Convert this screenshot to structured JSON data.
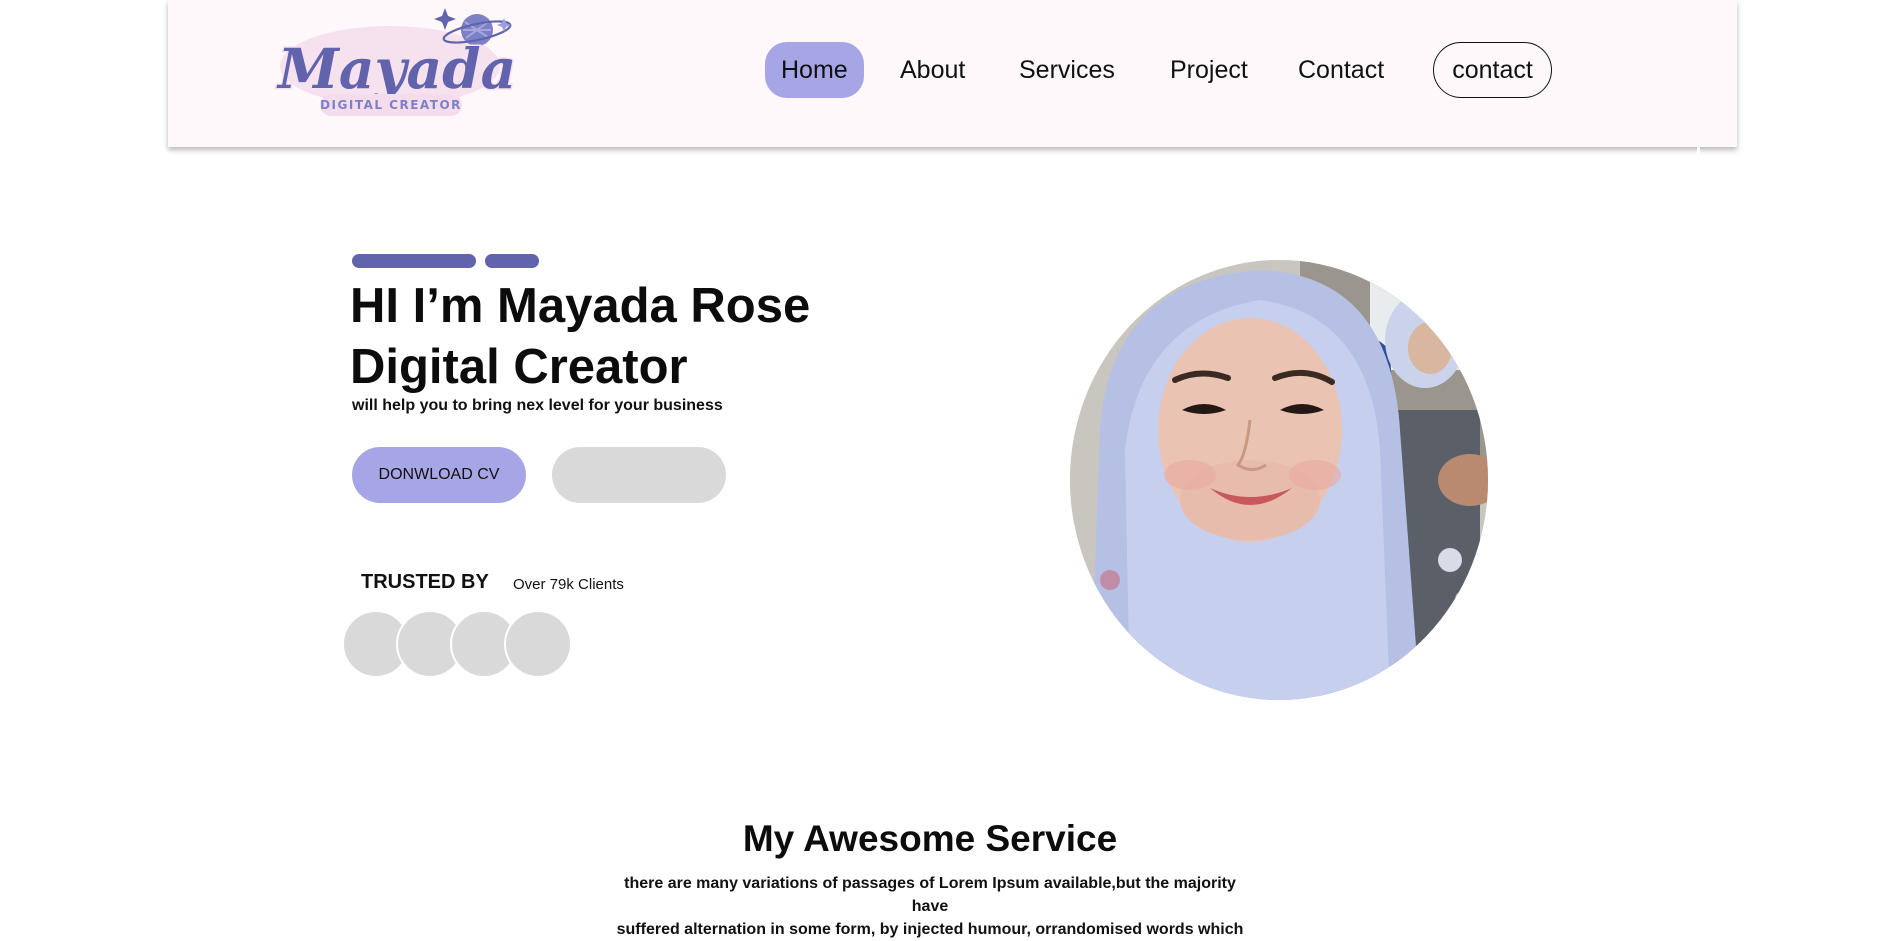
{
  "brand": {
    "logo_text": "Mayada",
    "logo_subtext": "DIGITAL CREATOR"
  },
  "nav": {
    "items": [
      {
        "label": "Home",
        "active": true
      },
      {
        "label": "About",
        "active": false
      },
      {
        "label": "Services",
        "active": false
      },
      {
        "label": "Project",
        "active": false
      },
      {
        "label": "Contact",
        "active": false
      }
    ],
    "contact_button": "contact"
  },
  "hero": {
    "title_line1": "HI I’m Mayada Rose",
    "title_line2": "Digital Creator",
    "subtitle": "will help you to bring nex level for your business",
    "cv_button": "DONWLOAD CV",
    "secondary_button": "",
    "trusted_label": "TRUSTED BY",
    "trusted_count": "Over 79k Clients"
  },
  "services": {
    "title": "My Awesome Service",
    "description_lines": [
      "there are  many variations of passages of Lorem Ipsum available,but the majority",
      "have",
      "suffered alternation in some form, by injected humour, orrandomised words which"
    ]
  },
  "colors": {
    "accent": "#6163ad",
    "accent_light": "#a6a6e6",
    "header_bg": "#fff8fb",
    "placeholder": "#d9d9d9"
  }
}
